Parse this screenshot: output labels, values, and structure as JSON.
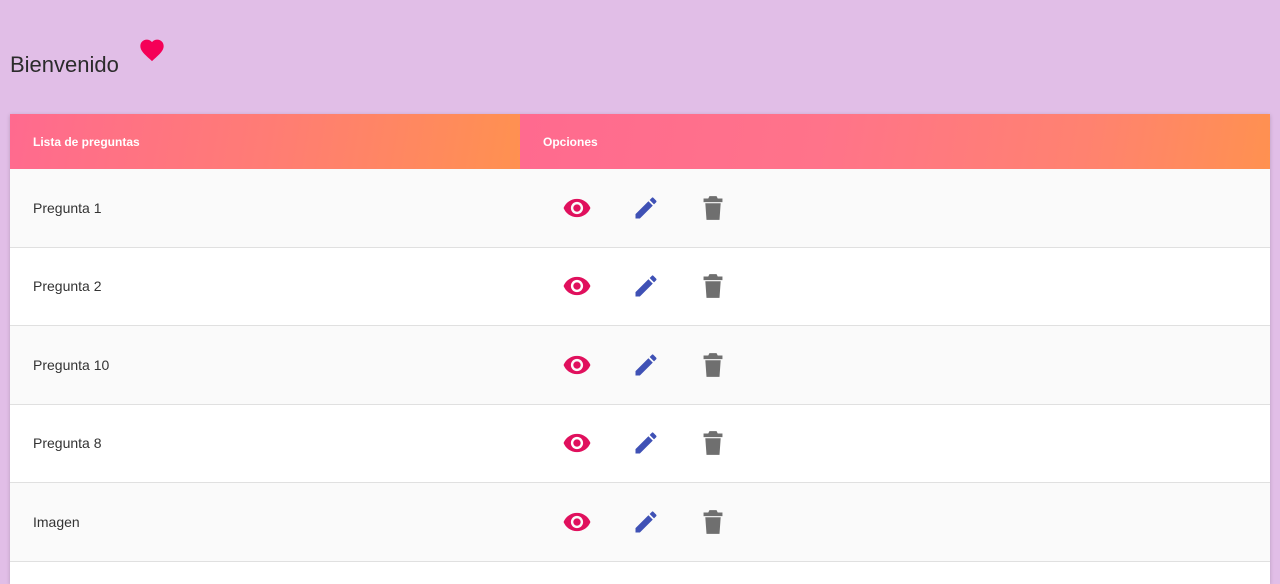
{
  "header": {
    "title": "Bienvenido",
    "icon": "heart-icon",
    "icon_color": "#f50057"
  },
  "table": {
    "columns": [
      "Lista de preguntas",
      "Opciones"
    ],
    "rows": [
      {
        "name": "Pregunta 1"
      },
      {
        "name": "Pregunta 2"
      },
      {
        "name": "Pregunta 10"
      },
      {
        "name": "Pregunta 8"
      },
      {
        "name": "Imagen"
      }
    ],
    "actions": [
      {
        "icon": "eye-icon",
        "color": "#e0105d"
      },
      {
        "icon": "pencil-icon",
        "color": "#3f51b5"
      },
      {
        "icon": "trash-icon",
        "color": "#6f6f6f"
      }
    ]
  },
  "colors": {
    "background": "#e1bee7",
    "header_gradient_start": "#ff6a8f",
    "header_gradient_end": "#ff9150"
  }
}
